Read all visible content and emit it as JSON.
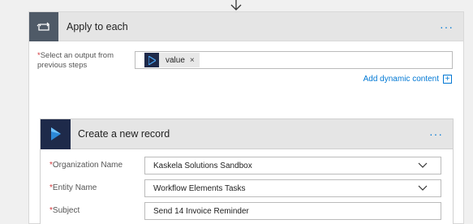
{
  "apply": {
    "title": "Apply to each",
    "more": "···",
    "select_label_required": "*",
    "select_label": "Select an output from previous steps",
    "token_value": "value",
    "token_remove": "×",
    "add_dynamic": "Add dynamic content",
    "add_dynamic_plus": "+"
  },
  "record": {
    "title": "Create a new record",
    "more": "···",
    "fields": [
      {
        "label": "Organization Name",
        "required": "*",
        "value": "Kaskela Solutions Sandbox",
        "type": "dropdown"
      },
      {
        "label": "Entity Name",
        "required": "*",
        "value": "Workflow Elements Tasks",
        "type": "dropdown"
      },
      {
        "label": "Subject",
        "required": "*",
        "value": "Send 14 Invoice Reminder",
        "type": "text"
      }
    ]
  },
  "colors": {
    "loop_icon_bg": "#4f5a67",
    "dynamics_icon_bg": "#1e2a4a",
    "accent": "#0078d4",
    "required": "#d13438"
  },
  "icons": {
    "flow_arrow": "down-arrow-icon",
    "loop": "loop-icon",
    "dynamics": "dynamics-play-icon",
    "chevron": "chevron-down-icon"
  }
}
